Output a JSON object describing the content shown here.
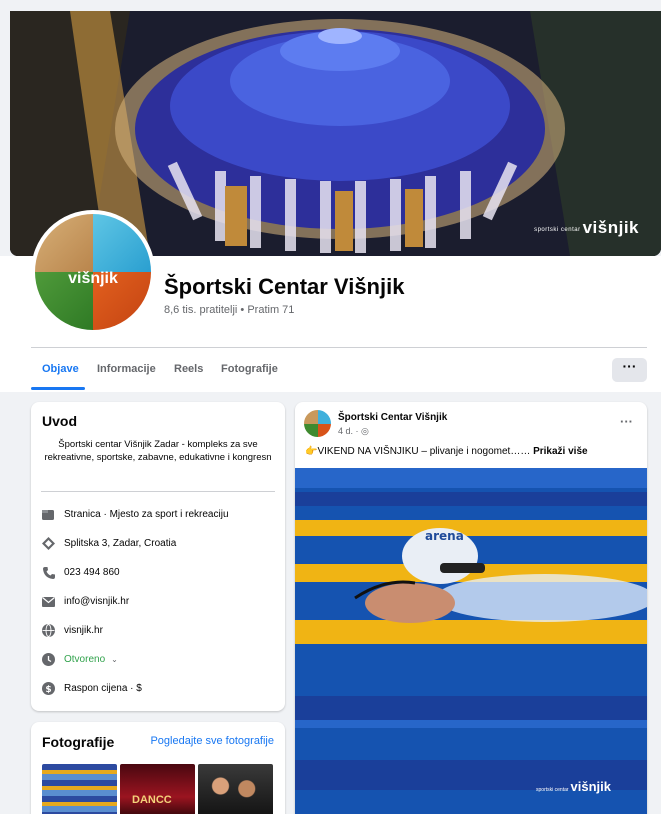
{
  "page": {
    "name": "Športski Centar Višnjik",
    "followers": "8,6 tis. pratitelji • Pratim 71",
    "cover_logo": "višnjik",
    "cover_logo_small": "sportski centar"
  },
  "tabs": [
    {
      "label": "Objave",
      "active": true
    },
    {
      "label": "Informacije",
      "active": false
    },
    {
      "label": "Reels",
      "active": false
    },
    {
      "label": "Fotografije",
      "active": false
    }
  ],
  "more_label": "···",
  "intro": {
    "title": "Uvod",
    "description": "Športski centar Višnjik Zadar - kompleks za sve rekreativne, sportske, zabavne, edukativne i kongresn",
    "rows": [
      {
        "icon": "flag-icon",
        "text": "Stranica · Mjesto za sport i rekreaciju"
      },
      {
        "icon": "location-icon",
        "text": "Splitska 3, Zadar, Croatia"
      },
      {
        "icon": "phone-icon",
        "text": "023 494 860"
      },
      {
        "icon": "mail-icon",
        "text": "info@visnjik.hr"
      },
      {
        "icon": "globe-icon",
        "text": "visnjik.hr"
      },
      {
        "icon": "clock-icon",
        "text": "Otvoreno",
        "status": true
      },
      {
        "icon": "price-icon",
        "text": "Raspon cijena · $"
      }
    ]
  },
  "photos": {
    "title": "Fotografije",
    "link": "Pogledajte sve fotografije",
    "thumb2_text": "DANCC"
  },
  "post": {
    "author": "Športski Centar Višnjik",
    "time": "4 d. · ",
    "text": "👉VIKEND NA VIŠNJIKU –  plivanje i nogomet……",
    "see_more": "Prikaži više",
    "more": "···",
    "image_logo": "višnjik",
    "image_logo_small": "sportski centar"
  },
  "colors": {
    "accent": "#1877f2",
    "open_status": "#31a24c"
  }
}
